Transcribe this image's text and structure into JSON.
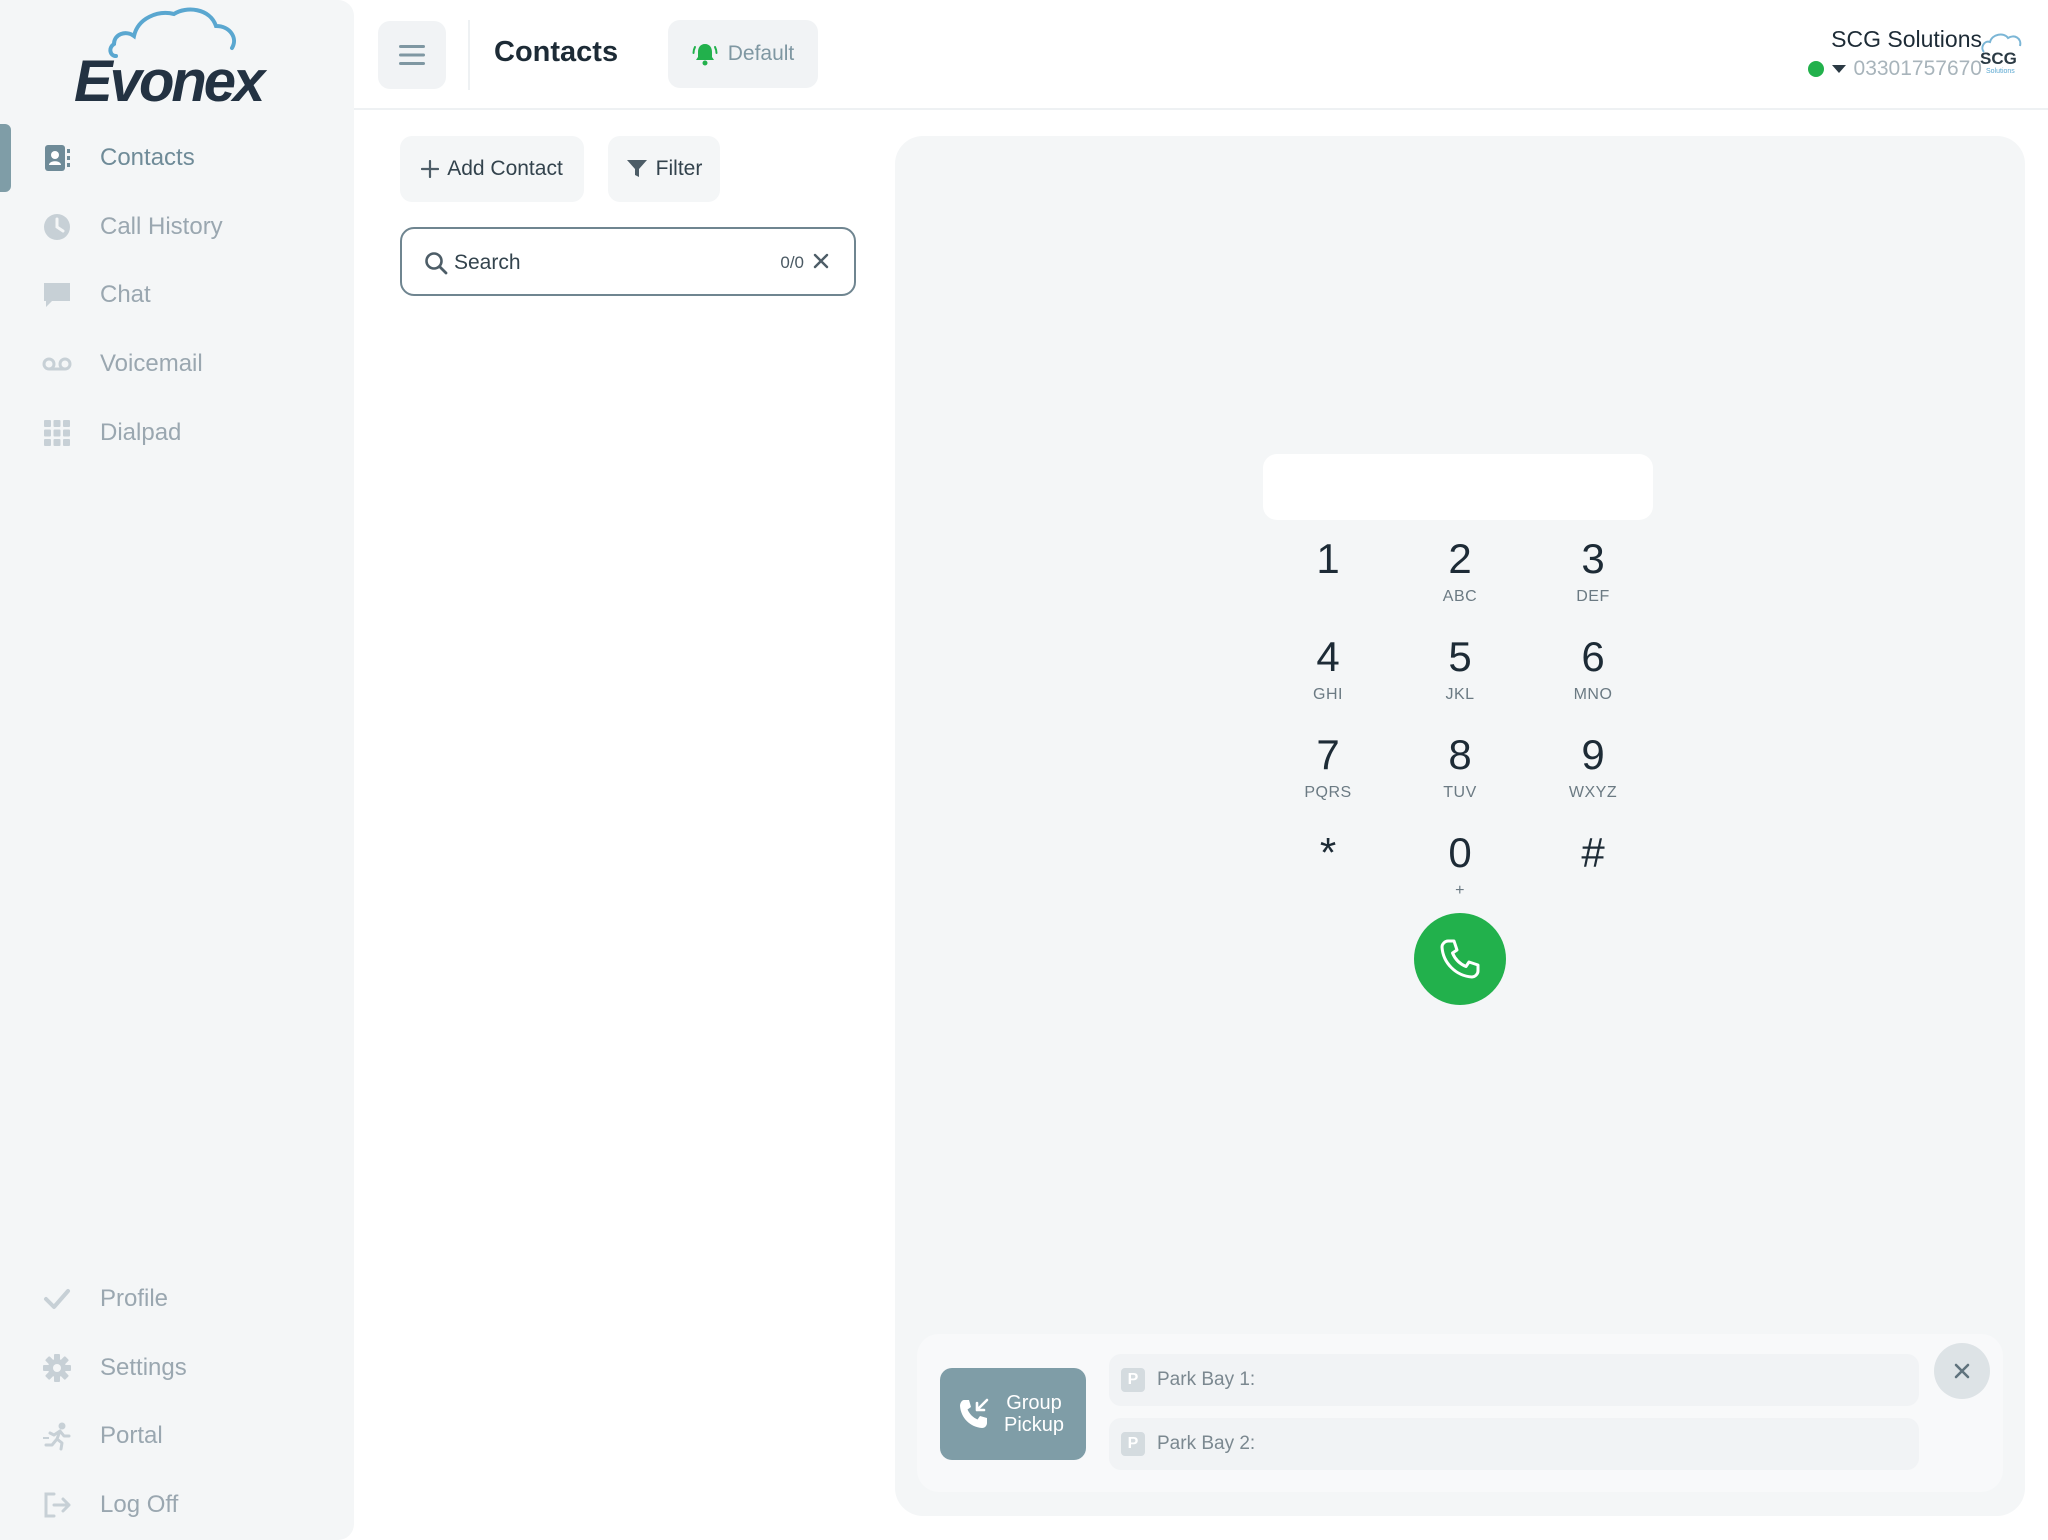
{
  "brand": {
    "logo_text": "Evonex"
  },
  "sidebar": {
    "items": [
      {
        "label": "Contacts",
        "icon": "contact-card-icon",
        "active": true
      },
      {
        "label": "Call History",
        "icon": "clock-icon"
      },
      {
        "label": "Chat",
        "icon": "chat-bubble-icon"
      },
      {
        "label": "Voicemail",
        "icon": "voicemail-icon"
      },
      {
        "label": "Dialpad",
        "icon": "dialpad-grid-icon"
      }
    ],
    "bottom_items": [
      {
        "label": "Profile",
        "icon": "check-icon"
      },
      {
        "label": "Settings",
        "icon": "gear-icon"
      },
      {
        "label": "Portal",
        "icon": "runner-icon"
      },
      {
        "label": "Log Off",
        "icon": "logout-icon"
      }
    ]
  },
  "header": {
    "title": "Contacts",
    "ring_profile_label": "Default",
    "company_name": "SCG Solutions",
    "phone_number": "03301757670",
    "status_color": "#22b14c"
  },
  "contacts": {
    "add_label": "Add Contact",
    "filter_label": "Filter",
    "search_placeholder": "Search",
    "search_count": "0/0"
  },
  "dialpad": {
    "input_value": "",
    "keys": [
      {
        "digit": "1",
        "letters": ""
      },
      {
        "digit": "2",
        "letters": "ABC"
      },
      {
        "digit": "3",
        "letters": "DEF"
      },
      {
        "digit": "4",
        "letters": "GHI"
      },
      {
        "digit": "5",
        "letters": "JKL"
      },
      {
        "digit": "6",
        "letters": "MNO"
      },
      {
        "digit": "7",
        "letters": "PQRS"
      },
      {
        "digit": "8",
        "letters": "TUV"
      },
      {
        "digit": "9",
        "letters": "WXYZ"
      },
      {
        "digit": "*",
        "letters": ""
      },
      {
        "digit": "0",
        "letters": "+"
      },
      {
        "digit": "#",
        "letters": ""
      }
    ],
    "call_color": "#22b14c"
  },
  "park": {
    "group_pickup_label": "Group Pickup",
    "bays": [
      {
        "label": "Park Bay 1:",
        "badge": "P"
      },
      {
        "label": "Park Bay 2:",
        "badge": "P"
      }
    ]
  },
  "colors": {
    "accent": "#7f9da7",
    "call_green": "#22b14c",
    "logo_navy": "#233242",
    "logo_cloud": "#5aa7d0"
  }
}
